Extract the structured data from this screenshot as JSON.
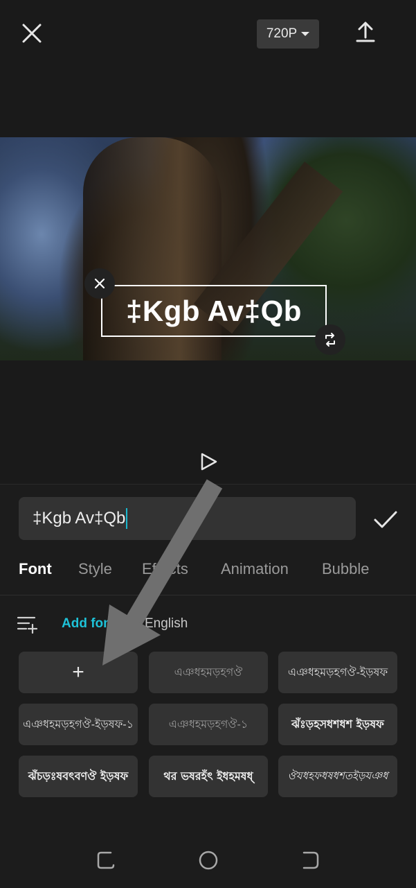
{
  "top_bar": {
    "resolution_label": "720P",
    "icons": [
      "close-icon",
      "caret-down-icon",
      "export-icon"
    ]
  },
  "preview": {
    "overlay_text": "‡Kgb Av‡Qb",
    "icons": [
      "close-icon",
      "rotate-icon"
    ]
  },
  "editor": {
    "input_value": "‡Kgb Av‡Qb",
    "confirm_icon": "check-icon",
    "tabs": [
      {
        "label": "Font",
        "active": true
      },
      {
        "label": "Style",
        "active": false
      },
      {
        "label": "Effects",
        "active": false
      },
      {
        "label": "Animation",
        "active": false
      },
      {
        "label": "Bubble",
        "active": false
      }
    ],
    "add_font_label": "Add font",
    "language_label": "English",
    "add_font_card_symbol": "+",
    "font_cards": [
      "এঞধহমড়হগঔ",
      "এঞধহমড়হগঔ-ইড়ষফ",
      "এঞধহমড়হগঔ-ইড়ষফ-১",
      "এঞধহমড়হগঔ-১",
      "ঝঁঃড়হসধশধশ ইড়ষফ",
      "ঝঁচড়ঃষবৎবণঔ ইড়ষফ",
      "থর ভষরহঁৎ ইধহমষধ্",
      "ঔযধহফধষধশতইড়যঞধ"
    ]
  },
  "nav_bar": {
    "icons": [
      "recent-apps-icon",
      "home-icon",
      "back-icon"
    ]
  },
  "colors": {
    "accent": "#1ec2d8",
    "background": "#1a1a1a",
    "card": "#333333"
  }
}
